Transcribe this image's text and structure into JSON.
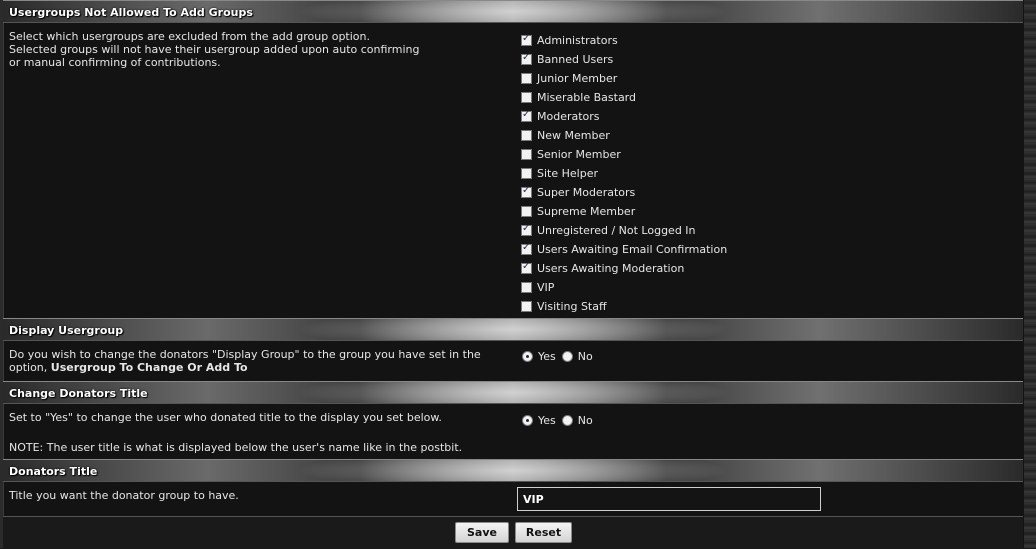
{
  "sections": {
    "usergroups": {
      "header": "Usergroups Not Allowed To Add Groups",
      "desc_line1": "Select which usergroups are excluded from the add group option.",
      "desc_line2": "Selected groups will not have their usergroup added upon auto confirming",
      "desc_line3": "or manual confirming of contributions.",
      "groups": [
        {
          "label": "Administrators",
          "checked": true
        },
        {
          "label": "Banned Users",
          "checked": true
        },
        {
          "label": "Junior Member",
          "checked": false
        },
        {
          "label": "Miserable Bastard",
          "checked": false
        },
        {
          "label": "Moderators",
          "checked": true
        },
        {
          "label": "New Member",
          "checked": false
        },
        {
          "label": "Senior Member",
          "checked": false
        },
        {
          "label": "Site Helper",
          "checked": false
        },
        {
          "label": "Super Moderators",
          "checked": true
        },
        {
          "label": "Supreme Member",
          "checked": false
        },
        {
          "label": "Unregistered / Not Logged In",
          "checked": true
        },
        {
          "label": "Users Awaiting Email Confirmation",
          "checked": true
        },
        {
          "label": "Users Awaiting Moderation",
          "checked": true
        },
        {
          "label": "VIP",
          "checked": false
        },
        {
          "label": "Visiting Staff",
          "checked": false
        }
      ]
    },
    "display_usergroup": {
      "header": "Display Usergroup",
      "desc_line1": "Do you wish to change the donators \"Display Group\" to the group you have set in the",
      "desc_line2_prefix": "option,",
      "desc_line2_bold": "Usergroup To Change Or Add To",
      "yes_label": "Yes",
      "no_label": "No",
      "selected": "Yes"
    },
    "change_title": {
      "header": "Change Donators Title",
      "desc_line1": "Set to \"Yes\" to change the user who donated title to the display you set below.",
      "note": "NOTE: The user title is what is displayed below the user's name like in the postbit.",
      "yes_label": "Yes",
      "no_label": "No",
      "selected": "Yes"
    },
    "donators_title": {
      "header": "Donators Title",
      "desc": "Title you want the donator group to have.",
      "value": "VIP"
    }
  },
  "buttons": {
    "save": "Save",
    "reset": "Reset"
  }
}
